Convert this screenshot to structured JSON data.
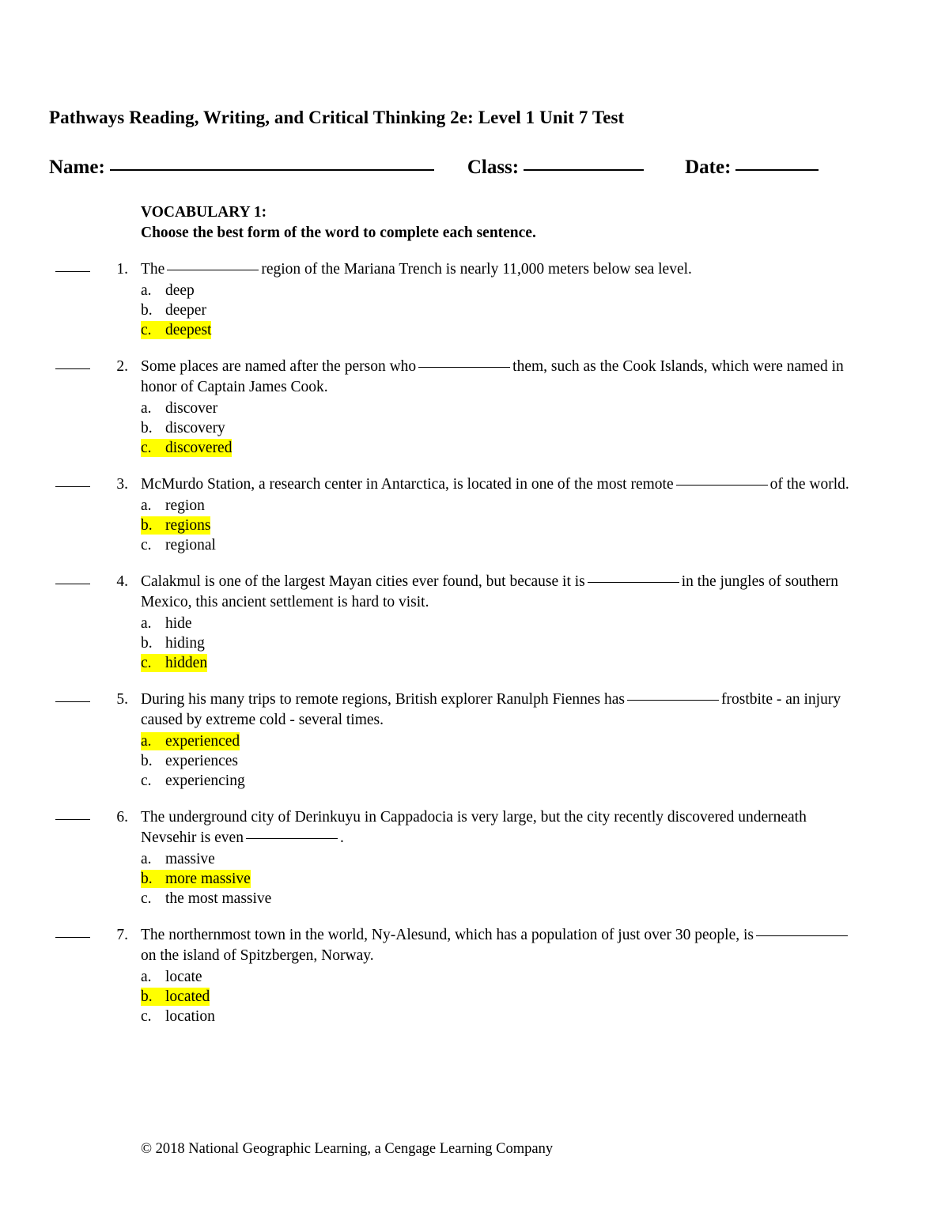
{
  "document": {
    "title": "Pathways Reading, Writing, and Critical Thinking 2e: Level 1 Unit 7 Test"
  },
  "id_row": {
    "name_label": "Name:",
    "class_label": "Class:",
    "date_label": "Date:",
    "name_value": "",
    "class_value": "",
    "date_value": ""
  },
  "section": {
    "heading": "VOCABULARY 1:",
    "instruction": "Choose the best form of the word to complete each sentence."
  },
  "highlight_color": "#FFFF00",
  "questions": [
    {
      "number": "1.",
      "text_before": "The",
      "text_after": "region of the Mariana Trench is nearly 11,000 meters below sea level.",
      "options": [
        {
          "mark": "a.",
          "label": "deep",
          "highlighted": false
        },
        {
          "mark": "b.",
          "label": "deeper",
          "highlighted": false
        },
        {
          "mark": "c.",
          "label": "deepest",
          "highlighted": true
        }
      ]
    },
    {
      "number": "2.",
      "text_before": "Some places are named after the person who",
      "text_after": "them, such as the Cook Islands, which were named in honor of Captain James Cook.",
      "options": [
        {
          "mark": "a.",
          "label": "discover",
          "highlighted": false
        },
        {
          "mark": "b.",
          "label": "discovery",
          "highlighted": false
        },
        {
          "mark": "c.",
          "label": "discovered",
          "highlighted": true
        }
      ]
    },
    {
      "number": "3.",
      "text_before": "McMurdo Station, a research center in Antarctica, is located in one of the most remote",
      "text_after": "of the world.",
      "options": [
        {
          "mark": "a.",
          "label": "region",
          "highlighted": false
        },
        {
          "mark": "b.",
          "label": "regions",
          "highlighted": true
        },
        {
          "mark": "c.",
          "label": "regional",
          "highlighted": false
        }
      ]
    },
    {
      "number": "4.",
      "text_before": "Calakmul is one of the largest Mayan cities ever found, but because it is",
      "text_after": "in the jungles of southern Mexico, this ancient settlement is hard to visit.",
      "options": [
        {
          "mark": "a.",
          "label": "hide",
          "highlighted": false
        },
        {
          "mark": "b.",
          "label": "hiding",
          "highlighted": false
        },
        {
          "mark": "c.",
          "label": "hidden",
          "highlighted": true
        }
      ]
    },
    {
      "number": "5.",
      "text_before": "During his many trips to remote regions, British explorer Ranulph Fiennes has",
      "text_after": "frostbite - an injury caused by extreme cold - several times.",
      "options": [
        {
          "mark": "a.",
          "label": "experienced",
          "highlighted": true
        },
        {
          "mark": "b.",
          "label": "experiences",
          "highlighted": false
        },
        {
          "mark": "c.",
          "label": "experiencing",
          "highlighted": false
        }
      ]
    },
    {
      "number": "6.",
      "text_before": "The underground city of Derinkuyu in Cappadocia is very large, but the city recently discovered underneath Nevsehir is even",
      "text_after": ".",
      "options": [
        {
          "mark": "a.",
          "label": "massive",
          "highlighted": false
        },
        {
          "mark": "b.",
          "label": "more massive",
          "highlighted": true
        },
        {
          "mark": "c.",
          "label": "the most massive",
          "highlighted": false
        }
      ]
    },
    {
      "number": "7.",
      "text_before": "The northernmost town in the world, Ny-Alesund, which has a population of just over 30 people, is",
      "text_after": "on the island of Spitzbergen, Norway.",
      "options": [
        {
          "mark": "a.",
          "label": "locate",
          "highlighted": false
        },
        {
          "mark": "b.",
          "label": "located",
          "highlighted": true
        },
        {
          "mark": "c.",
          "label": "location",
          "highlighted": false
        }
      ]
    }
  ],
  "footer": {
    "copyright": "© 2018 National Geographic Learning, a Cengage Learning Company"
  }
}
